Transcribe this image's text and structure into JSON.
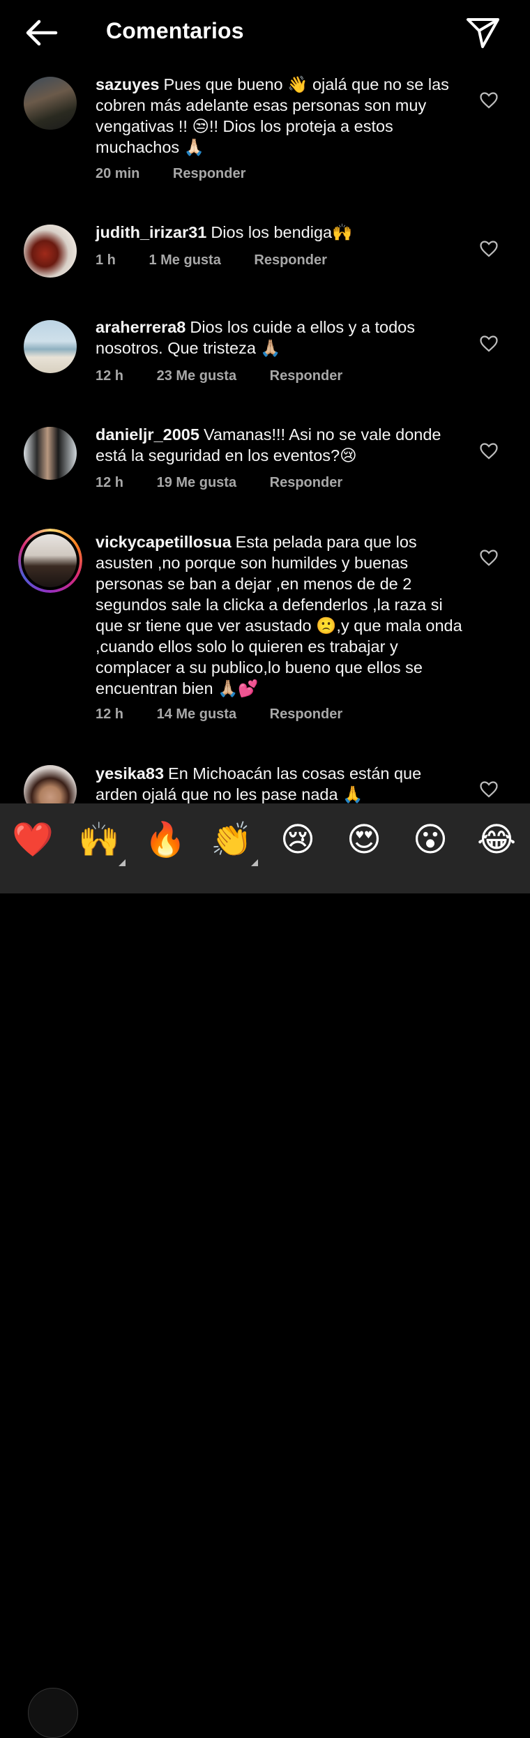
{
  "header": {
    "title": "Comentarios",
    "back_icon": "arrow-left-icon",
    "send_icon": "paper-plane-icon"
  },
  "comments": [
    {
      "username": "sazuyes",
      "text": "Pues que bueno 👋 ojalá que no  se las cobren más adelante esas personas son muy vengativas !! 😒!! Dios los proteja a estos muchachos 🙏🏻",
      "time": "20 min",
      "likes": "",
      "reply": "Responder"
    },
    {
      "username": "judith_irizar31",
      "text": "Dios los bendiga🙌",
      "time": "1 h",
      "likes": "1 Me gusta",
      "reply": "Responder"
    },
    {
      "username": "araherrera8",
      "text": "Dios los cuide a ellos y a todos nosotros. Que tristeza 🙏🏼",
      "time": "12 h",
      "likes": "23 Me gusta",
      "reply": "Responder"
    },
    {
      "username": "danieljr_2005",
      "text": "Vamanas!!! Asi no se vale donde está la seguridad en los eventos?😢",
      "time": "12 h",
      "likes": "19 Me gusta",
      "reply": "Responder"
    },
    {
      "username": "vickycapetillosua",
      "text": "Esta pelada para que los asusten ,no porque son humildes y buenas personas se ban a dejar ,en menos de de 2 segundos sale la clicka a defenderlos ,la raza si que sr tiene que ver asustado 🙁,y que mala onda ,cuando ellos solo lo quieren es trabajar y complacer a su publico,lo bueno que ellos se encuentran bien 🙏🏼💕",
      "time": "12 h",
      "likes": "14 Me gusta",
      "reply": "Responder"
    },
    {
      "username": "yesika83",
      "text": "En Michoacán las cosas están que arden ojalá que no les pase nada 🙏",
      "time": "",
      "likes": "",
      "reply": ""
    }
  ],
  "quick_reactions": [
    "❤️",
    "🙌",
    "🔥",
    "👏",
    "😢",
    "😍",
    "😮",
    "😂"
  ],
  "colors": {
    "background": "#000000",
    "secondary_text": "#a8a8a8",
    "bar": "#262626"
  }
}
